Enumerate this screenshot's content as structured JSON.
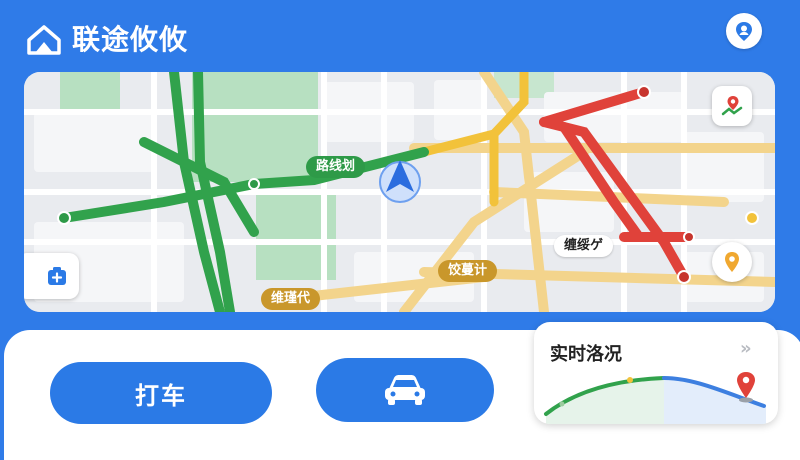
{
  "header": {
    "app_title": "联途攸攸"
  },
  "map": {
    "road_labels": {
      "green": "路线划",
      "amber1": "饺蔓计",
      "amber2": "维瑾代",
      "white": "缠绥ゲ"
    }
  },
  "actions": {
    "taxi_label": "打车"
  },
  "traffic_card": {
    "title": "实时洛况",
    "more": "»"
  },
  "colors": {
    "brand": "#2f7be8",
    "green": "#31a24c",
    "yellow": "#f2c23a",
    "red": "#e0423a",
    "amber_label": "#c9972b"
  },
  "icons": [
    "logo-icon",
    "profile-icon",
    "route-pin-icon",
    "add-layer-icon",
    "location-pin-icon",
    "navigation-arrow-icon",
    "car-icon",
    "destination-pin-icon"
  ]
}
